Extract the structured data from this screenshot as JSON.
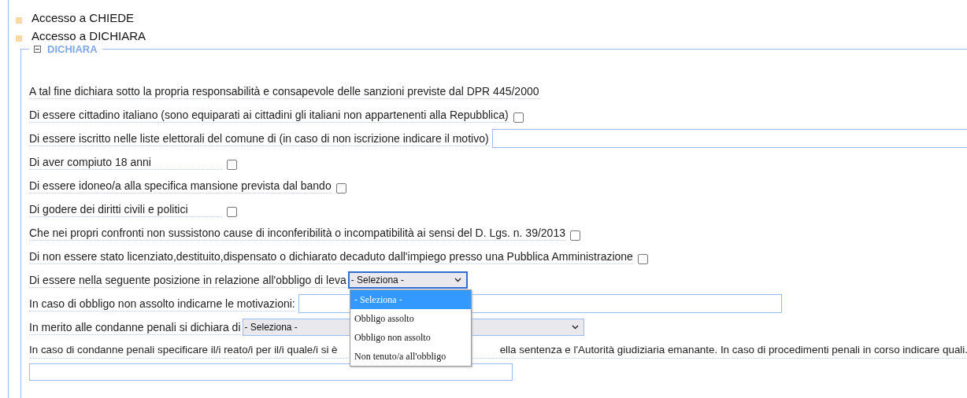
{
  "access_links": [
    {
      "label": "Accesso a CHIEDE"
    },
    {
      "label": "Accesso a DICHIARA"
    }
  ],
  "section": {
    "title": "DICHIARA",
    "expanded": true,
    "rows": [
      {
        "kind": "text",
        "label": "A tal fine dichiara sotto la propria responsabilità e consapevole delle sanzioni previste dal DPR 445/2000"
      },
      {
        "kind": "checkbox",
        "label": "Di essere cittadino italiano (sono equiparati ai cittadini gli italiani non appartenenti alla Repubblica)",
        "checked": false
      },
      {
        "kind": "input",
        "label": "Di essere iscritto nelle liste elettorali del comune di (in caso di non iscrizione indicare il motivo)"
      },
      {
        "kind": "checkbox",
        "label": "Di aver compiuto 18 anni",
        "checked": false
      },
      {
        "kind": "checkbox",
        "label": "Di essere idoneo/a alla specifica mansione prevista dal bando",
        "checked": false
      },
      {
        "kind": "checkbox",
        "label": "Di godere dei diritti civili e politici",
        "checked": false
      },
      {
        "kind": "checkbox",
        "label": "Che nei propri confronti non sussistono cause di inconferibilità o incompatibilità ai sensi del D. Lgs. n. 39/2013",
        "checked": false
      },
      {
        "kind": "checkbox",
        "label": "Di non essere stato licenziato,destituito,dispensato o dichiarato decaduto dall'impiego presso una Pubblica Amministrazione",
        "checked": false
      },
      {
        "kind": "select",
        "label": "Di essere nella seguente posizione in relazione all'obbligo di leva",
        "value": "- Seleziona -",
        "open": true,
        "options": [
          {
            "label": "- Seleziona -",
            "selected": true
          },
          {
            "label": "Obbligo assolto",
            "selected": false
          },
          {
            "label": "Obbligo non assolto",
            "selected": false
          },
          {
            "label": "Non tenuto/a all'obbligo",
            "selected": false
          }
        ]
      },
      {
        "kind": "input",
        "label": "In caso di obbligo non assolto indicarne le motivazioni:"
      },
      {
        "kind": "select",
        "label": "In merito alle condanne penali si dichiara di",
        "value": "- Seleziona -",
        "open": false
      },
      {
        "kind": "block",
        "label_parts": [
          "In caso di condanne penali specificare il/i reato/i per il/i quale/i si è",
          "ella sentenza e l'Autorità giudiziaria emanante. In caso di procedimenti penali in corso indicare quali."
        ]
      }
    ]
  }
}
